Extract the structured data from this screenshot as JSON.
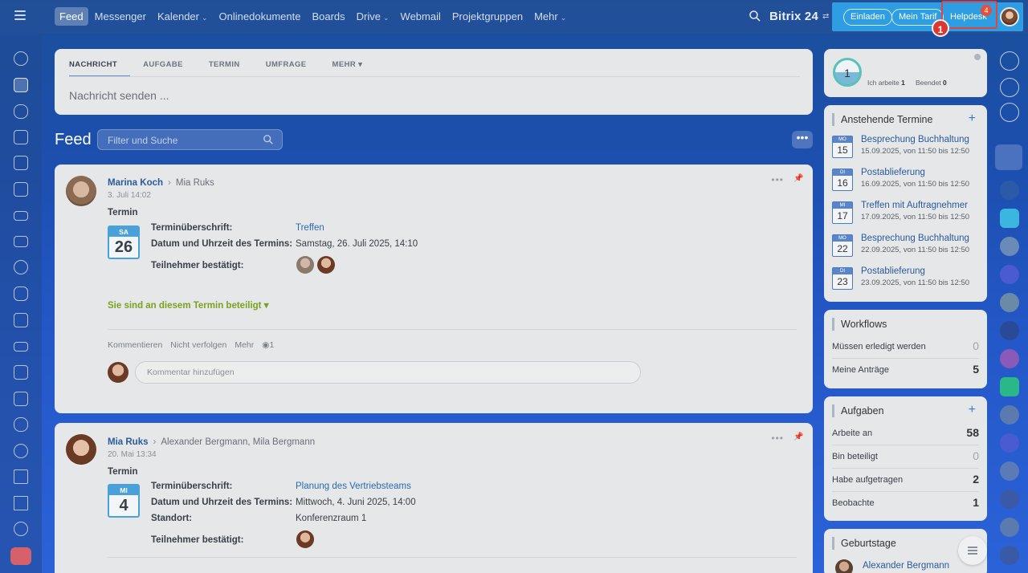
{
  "topbar": {
    "nav": [
      {
        "label": "Feed",
        "active": true
      },
      {
        "label": "Messenger"
      },
      {
        "label": "Kalender",
        "dropdown": true
      },
      {
        "label": "Onlinedokumente"
      },
      {
        "label": "Boards"
      },
      {
        "label": "Drive",
        "dropdown": true
      },
      {
        "label": "Webmail"
      },
      {
        "label": "Projektgruppen"
      },
      {
        "label": "Mehr",
        "dropdown": true
      }
    ],
    "brand": "Bitrix 24",
    "invite_label": "Einladen",
    "tariff_label": "Mein Tarif",
    "helpdesk_label": "Helpdesk",
    "helpdesk_badge": "4",
    "step_marker": "1"
  },
  "composer": {
    "tabs": [
      "NACHRICHT",
      "AUFGABE",
      "TERMIN",
      "UMFRAGE",
      "MEHR"
    ],
    "placeholder": "Nachricht senden ..."
  },
  "feed": {
    "title": "Feed",
    "filter_placeholder": "Filter und Suche",
    "more_label": "•••"
  },
  "posts": [
    {
      "author": "Marina Koch",
      "recipient": "Mia Ruks",
      "date": "3. Juli 14:02",
      "type": "Termin",
      "cal_dow": "SA",
      "cal_day": "26",
      "fields": [
        {
          "k": "Terminüberschrift:",
          "v": "Treffen"
        },
        {
          "k": "Datum und Uhrzeit des Termins:",
          "v": "Samstag, 26. Juli 2025, 14:10"
        },
        {
          "k": "Teilnehmer bestätigt:",
          "v": ""
        }
      ],
      "participation": "Sie sind an diesem Termin beteiligt",
      "actions": [
        "Kommentieren",
        "Nicht verfolgen",
        "Mehr"
      ],
      "views": "1",
      "comment_placeholder": "Kommentar hinzufügen"
    },
    {
      "author": "Mia Ruks",
      "recipient": "Alexander Bergmann, Mila Bergmann",
      "date": "20. Mai 13:34",
      "type": "Termin",
      "cal_dow": "MI",
      "cal_day": "4",
      "fields": [
        {
          "k": "Terminüberschrift:",
          "v": "Planung des Vertriebsteams"
        },
        {
          "k": "Datum und Uhrzeit des Termins:",
          "v": "Mittwoch, 4. Juni 2025, 14:00"
        },
        {
          "k": "Standort:",
          "v": "Konferenzraum 1"
        },
        {
          "k": "Teilnehmer bestätigt:",
          "v": ""
        }
      ]
    }
  ],
  "widgets": {
    "work_counter": {
      "value": "1",
      "working_label": "Ich arbeite",
      "working_count": "1",
      "done_label": "Beendet",
      "done_count": "0"
    },
    "appointments": {
      "title": "Anstehende Termine",
      "items": [
        {
          "dow": "MO",
          "day": "15",
          "title": "Besprechung Buchhaltung",
          "sub": "15.09.2025, von 11:50 bis 12:50"
        },
        {
          "dow": "DI",
          "day": "16",
          "title": "Postablieferung",
          "sub": "16.09.2025, von 11:50 bis 12:50"
        },
        {
          "dow": "MI",
          "day": "17",
          "title": "Treffen mit Auftragnehmer",
          "sub": "17.09.2025, von 11:50 bis 12:50"
        },
        {
          "dow": "MO",
          "day": "22",
          "title": "Besprechung Buchhaltung",
          "sub": "22.09.2025, von 11:50 bis 12:50"
        },
        {
          "dow": "DI",
          "day": "23",
          "title": "Postablieferung",
          "sub": "23.09.2025, von 11:50 bis 12:50"
        }
      ]
    },
    "workflows": {
      "title": "Workflows",
      "rows": [
        {
          "label": "Müssen erledigt werden",
          "value": "0"
        },
        {
          "label": "Meine Anträge",
          "value": "5"
        }
      ]
    },
    "tasks": {
      "title": "Aufgaben",
      "rows": [
        {
          "label": "Arbeite an",
          "value": "58"
        },
        {
          "label": "Bin beteiligt",
          "value": "0"
        },
        {
          "label": "Habe aufgetragen",
          "value": "2"
        },
        {
          "label": "Beobachte",
          "value": "1"
        }
      ]
    },
    "birthdays": {
      "title": "Geburtstage",
      "first": "Alexander Bergmann"
    }
  }
}
